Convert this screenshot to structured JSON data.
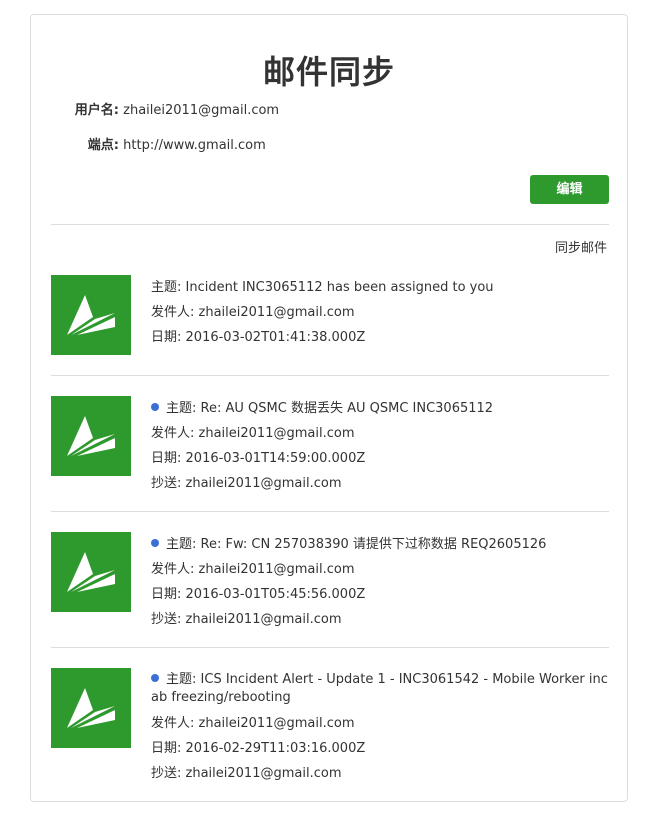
{
  "page": {
    "title": "邮件同步"
  },
  "account": {
    "username_label": "用户名:",
    "username_value": "zhailei2011@gmail.com",
    "endpoint_label": "端点:",
    "endpoint_value": "http://www.gmail.com"
  },
  "actions": {
    "edit_label": "编辑",
    "sync_label": "同步邮件"
  },
  "labels": {
    "subject": "主题:",
    "from": "发件人:",
    "date": "日期:",
    "cc": "抄送:"
  },
  "colors": {
    "accent_green": "#2e9a2e",
    "unread_dot": "#3b6fd6"
  },
  "icons": {
    "mail_thumbnail": "paper-plane-icon",
    "unread_marker": "unread-dot-icon"
  },
  "mails": [
    {
      "unread": false,
      "subject": "Incident INC3065112 has been assigned to you",
      "from": "zhailei2011@gmail.com",
      "date": "2016-03-02T01:41:38.000Z",
      "cc": ""
    },
    {
      "unread": true,
      "subject": "Re: AU QSMC 数据丢失 AU QSMC INC3065112",
      "from": "zhailei2011@gmail.com",
      "date": "2016-03-01T14:59:00.000Z",
      "cc": "zhailei2011@gmail.com"
    },
    {
      "unread": true,
      "subject": "Re: Fw: CN 257038390 请提供下过称数据 REQ2605126",
      "from": "zhailei2011@gmail.com",
      "date": "2016-03-01T05:45:56.000Z",
      "cc": "zhailei2011@gmail.com"
    },
    {
      "unread": true,
      "subject": "ICS Incident Alert - Update 1 - INC3061542 - Mobile Worker incab freezing/rebooting",
      "from": "zhailei2011@gmail.com",
      "date": "2016-02-29T11:03:16.000Z",
      "cc": "zhailei2011@gmail.com"
    }
  ]
}
